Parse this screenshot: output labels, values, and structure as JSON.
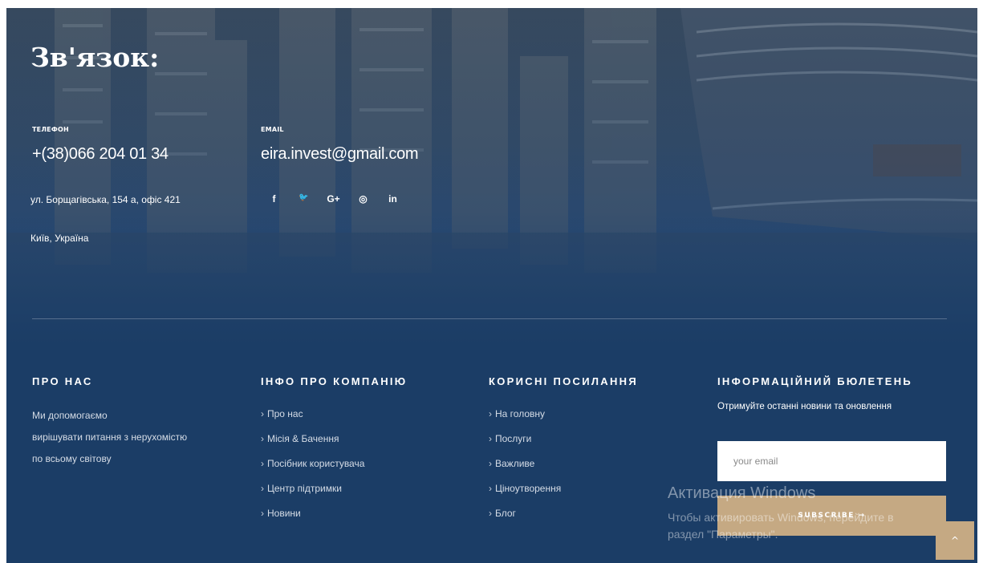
{
  "contact": {
    "title": "Зв'язок:",
    "phone_label": "ТЕЛЕФОН",
    "phone": "+(38)066 204 01 34",
    "email_label": "EMAIL",
    "email": "eira.invest@gmail.com",
    "address_line1": "ул. Борщагівська, 154 а, офіс 421",
    "address_line2": "Київ, Україна",
    "social": [
      {
        "icon": "facebook-icon",
        "glyph": "f"
      },
      {
        "icon": "twitter-icon",
        "glyph": "🐦"
      },
      {
        "icon": "google-plus-icon",
        "glyph": "G+"
      },
      {
        "icon": "instagram-icon",
        "glyph": "◎"
      },
      {
        "icon": "linkedin-icon",
        "glyph": "in"
      }
    ]
  },
  "footer": {
    "about": {
      "heading": "ПРО НАС",
      "lines": [
        "Ми допомогаємо",
        "вирішувати питання з нерухомістю",
        "по всьому світову"
      ]
    },
    "company": {
      "heading": "ІНФО ПРО КОМПАНІЮ",
      "links": [
        "Про нас",
        "Місія & Бачення",
        "Посібник користувача",
        "Центр підтримки",
        "Новини"
      ]
    },
    "useful": {
      "heading": "КОРИСНІ ПОСИЛАННЯ",
      "links": [
        "На головну",
        "Послуги",
        "Важливе",
        "Ціноутворення",
        "Блог"
      ]
    },
    "newsletter": {
      "heading": "ІНФОРМАЦІЙНИЙ БЮЛЕТЕНЬ",
      "subtitle": "Отримуйте останні новини та оновлення",
      "email_placeholder": "your email",
      "subscribe_label": "SUBSCRIBE →"
    }
  },
  "watermark": {
    "title": "Активация Windows",
    "line1": "Чтобы активировать Windows, перейдите в",
    "line2": "раздел \"Параметры\"."
  },
  "to_top": {
    "glyph": "^"
  },
  "colors": {
    "footer_bg": "#1b3d66",
    "accent": "#c5a983",
    "text": "#ffffff"
  }
}
